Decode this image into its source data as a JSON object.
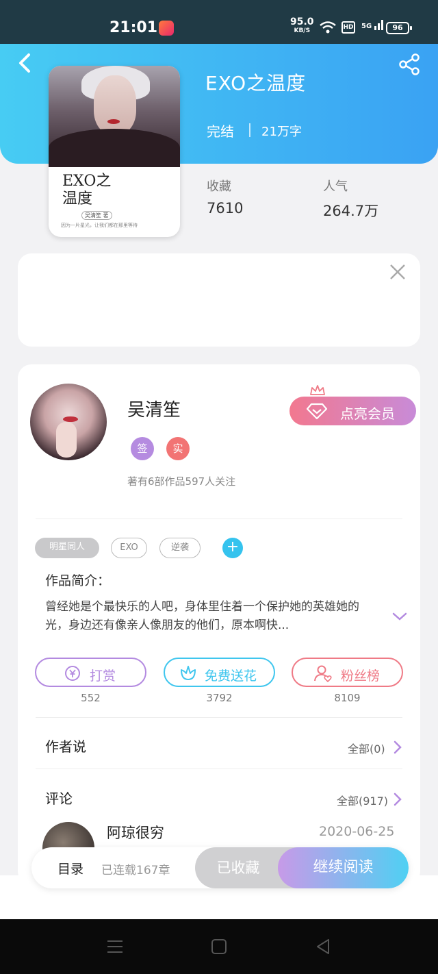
{
  "status_bar": {
    "time": "21:01",
    "speed_value": "95.0",
    "speed_unit": "KB/S",
    "hd": "HD",
    "network": "5G",
    "battery": "96"
  },
  "book": {
    "title": "EXO之温度",
    "status": "完结",
    "word_count": "21万字",
    "cover_title": "EXO之\n温度",
    "cover_author": "吴清笙 著",
    "cover_tagline": "因为一片星光，让我们都在那里等待",
    "stats": [
      {
        "label": "收藏",
        "value": "7610"
      },
      {
        "label": "人气",
        "value": "264.7万"
      }
    ]
  },
  "author": {
    "name": "吴清笙",
    "badges": [
      {
        "text": "签",
        "color": "#b58be0"
      },
      {
        "text": "实",
        "color": "#f27474"
      }
    ],
    "meta": "著有6部作品597人关注",
    "vip_label": "点亮会员"
  },
  "tags": [
    "明星同人",
    "EXO",
    "逆袭"
  ],
  "tag_add": "+",
  "intro": {
    "label": "作品简介：",
    "text": "曾经她是个最快乐的人吧，身体里住着一个保护她的英雄她的光，身边还有像亲人像朋友的他们，原本啊快..."
  },
  "actions": [
    {
      "label": "打赏",
      "count": "552",
      "color": "#b38ae0",
      "icon": "yen-coin-icon"
    },
    {
      "label": "免费送花",
      "count": "3792",
      "color": "#3fc6ee",
      "icon": "flower-icon"
    },
    {
      "label": "粉丝榜",
      "count": "8109",
      "color": "#ef7a86",
      "icon": "fans-rank-icon"
    }
  ],
  "author_says": {
    "title": "作者说",
    "link": "全部(0)"
  },
  "comments": {
    "title": "评论",
    "link": "全部(917)",
    "first": {
      "user": "阿琼很穷",
      "date": "2020-06-25"
    }
  },
  "bottom_bar": {
    "toc_label": "目录",
    "toc_info": "已连载167章",
    "collected_label": "已收藏",
    "read_label": "继续阅读"
  },
  "colors": {
    "header_start": "#47ccf3",
    "header_end": "#3aa2f3",
    "accent_purple": "#b38ae0",
    "accent_blue": "#3fc6ee",
    "accent_pink": "#ef7a86"
  }
}
